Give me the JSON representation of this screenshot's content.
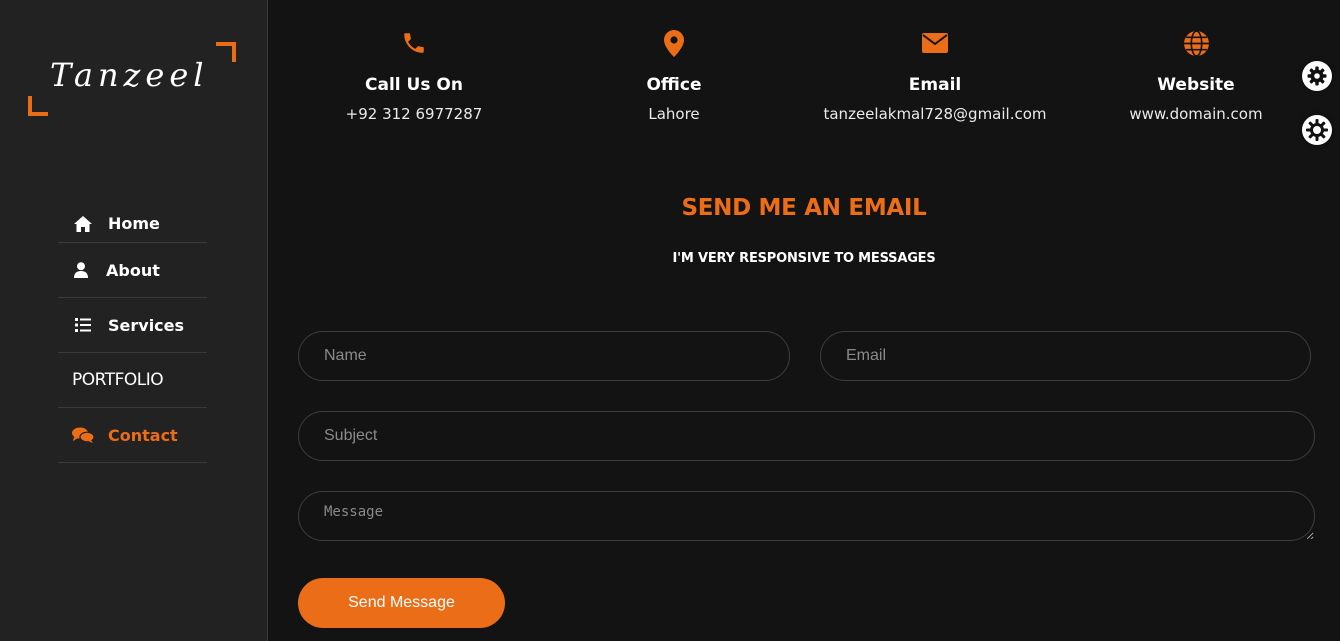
{
  "brand": {
    "logo_text": "Tanzeel",
    "accent": "#ec6d18"
  },
  "nav": {
    "items": [
      {
        "label": "Home",
        "icon": "home-icon"
      },
      {
        "label": "About",
        "icon": "user-icon"
      },
      {
        "label": "Services",
        "icon": "list-icon"
      },
      {
        "label": "PORTFOLIO",
        "icon": ""
      },
      {
        "label": "Contact",
        "icon": "chat-icon",
        "active": true
      }
    ]
  },
  "contact_info": [
    {
      "icon": "phone-icon",
      "title": "Call Us On",
      "value": "+92 312 6977287"
    },
    {
      "icon": "location-pin-icon",
      "title": "Office",
      "value": "Lahore"
    },
    {
      "icon": "envelope-icon",
      "title": "Email",
      "value": "tanzeelakmal728@gmail.com"
    },
    {
      "icon": "globe-icon",
      "title": "Website",
      "value": "www.domain.com"
    }
  ],
  "form": {
    "heading": "SEND ME AN EMAIL",
    "subheading": "I'M VERY RESPONSIVE TO MESSAGES",
    "name_placeholder": "Name",
    "email_placeholder": "Email",
    "subject_placeholder": "Subject",
    "message_placeholder": "Message",
    "submit_label": "Send Message"
  },
  "settings": {
    "icons": [
      "gear-icon",
      "sun-gear-icon"
    ]
  }
}
